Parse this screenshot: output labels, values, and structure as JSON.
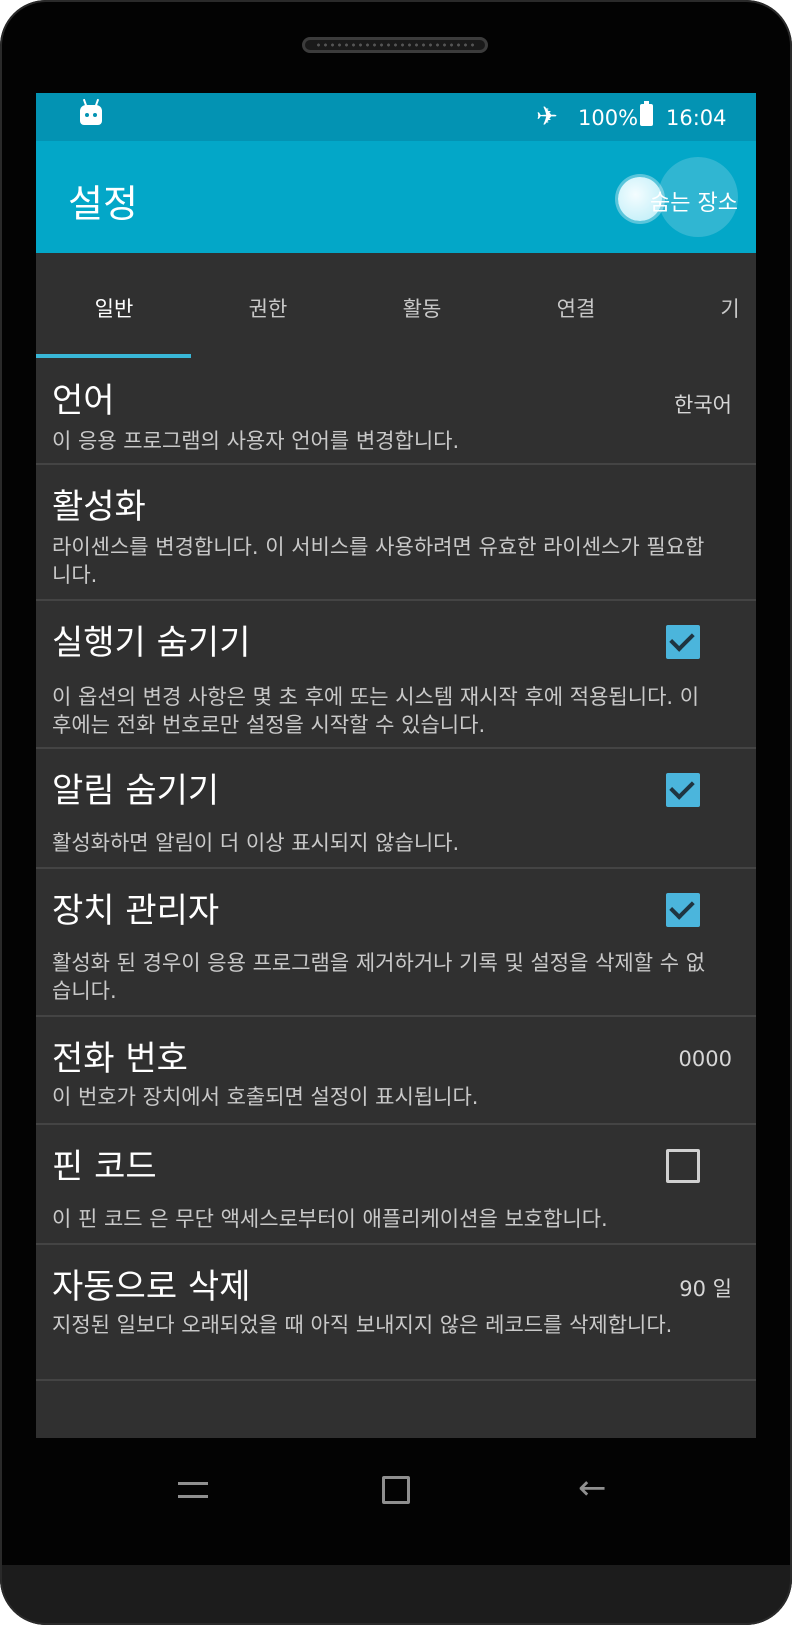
{
  "statusbar": {
    "battery": "100%",
    "time": "16:04",
    "icons": [
      "android-icon",
      "airplane-mode-icon",
      "battery-icon"
    ]
  },
  "appbar": {
    "title": "설정",
    "toggle_label": "숨는 장소"
  },
  "tabs": [
    "일반",
    "권한",
    "활동",
    "연결",
    "기"
  ],
  "settings": [
    {
      "title": "언어",
      "desc": "이 응용 프로그램의 사용자 언어를 변경합니다.",
      "value": "한국어"
    },
    {
      "title": "활성화",
      "desc": "라이센스를 변경합니다. 이 서비스를 사용하려면 유효한 라이센스가 필요합니다."
    },
    {
      "title": "실행기 숨기기",
      "desc": "이 옵션의 변경 사항은 몇 초 후에 또는 시스템 재시작 후에 적용됩니다. 이 후에는 전화 번호로만 설정을 시작할 수 있습니다.",
      "checked": true
    },
    {
      "title": "알림 숨기기",
      "desc": "활성화하면 알림이 더 이상 표시되지 않습니다.",
      "checked": true
    },
    {
      "title": "장치 관리자",
      "desc": "활성화 된 경우이 응용 프로그램을 제거하거나 기록 및 설정을 삭제할 수 없습니다.",
      "checked": true
    },
    {
      "title": "전화 번호",
      "desc": "이 번호가 장치에서 호출되면 설정이 표시됩니다.",
      "value": "0000"
    },
    {
      "title": "핀 코드",
      "desc": "이 핀 코드 은 무단 액세스로부터이 애플리케이션을 보호합니다.",
      "checked": false
    },
    {
      "title": "자동으로 삭제",
      "desc": "지정된 일보다 오래되었을 때 아직 보내지지 않은 레코드를 삭제합니다.",
      "value": "90 일"
    }
  ],
  "navbar": {
    "icons": [
      "recent-apps-icon",
      "home-icon",
      "back-icon"
    ]
  },
  "colors": {
    "statusbar": "#0393b3",
    "appbar": "#03a7c8",
    "background": "#303030",
    "accent": "#4bb5dc"
  }
}
